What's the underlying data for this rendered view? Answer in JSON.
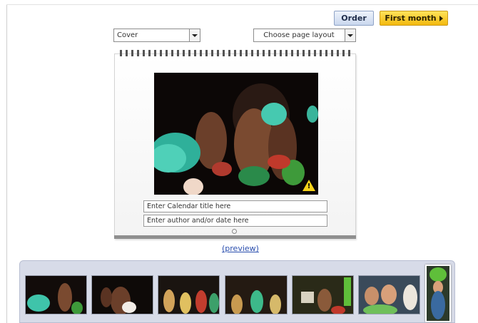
{
  "toolbar": {
    "order_label": "Order",
    "first_month_label": "First month"
  },
  "selectors": {
    "page_select_value": "Cover",
    "layout_select_value": "Choose page layout"
  },
  "calendar": {
    "title_input_value": "Enter Calendar title here",
    "author_input_value": "Enter author and/or date here",
    "warning_mark": "!"
  },
  "preview_link_label": "(preview)",
  "colors": {
    "order_button": "#c9d7ee",
    "first_month_button": "#f3b90e",
    "warning": "#f6d21a",
    "preview_link": "#2b4fae",
    "thumb_strip": "#d7dbe8"
  },
  "icons": {
    "dropdown": "chevron-down-icon",
    "next": "triangle-right-icon",
    "warning": "warning-icon",
    "refresh": "refresh-icon"
  }
}
